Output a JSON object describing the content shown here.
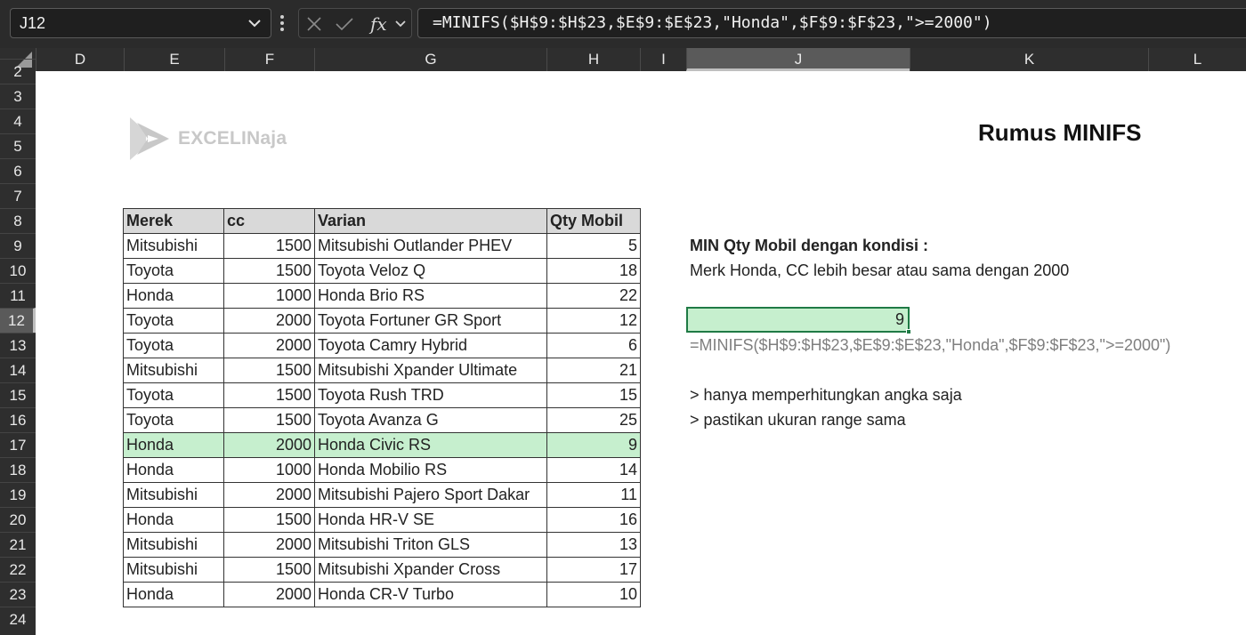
{
  "formula_bar": {
    "name_box": "J12",
    "formula": "=MINIFS($H$9:$H$23,$E$9:$E$23,\"Honda\",$F$9:$F$23,\">=2000\")"
  },
  "columns": [
    "D",
    "E",
    "F",
    "G",
    "H",
    "I",
    "J",
    "K",
    "L"
  ],
  "rows": [
    "2",
    "3",
    "4",
    "5",
    "6",
    "7",
    "8",
    "9",
    "10",
    "11",
    "12",
    "13",
    "14",
    "15",
    "16",
    "17",
    "18",
    "19",
    "20",
    "21",
    "22",
    "23",
    "24"
  ],
  "logo": {
    "text": "EXCELINaja"
  },
  "title": "Rumus MINIFS",
  "table": {
    "headers": [
      "Merek",
      "cc",
      "Varian",
      "Qty Mobil"
    ],
    "rows": [
      [
        "Mitsubishi",
        "1500",
        "Mitsubishi Outlander PHEV",
        "5"
      ],
      [
        "Toyota",
        "1500",
        "Toyota Veloz Q",
        "18"
      ],
      [
        "Honda",
        "1000",
        "Honda Brio RS",
        "22"
      ],
      [
        "Toyota",
        "2000",
        "Toyota Fortuner GR Sport",
        "12"
      ],
      [
        "Toyota",
        "2000",
        "Toyota Camry Hybrid",
        "6"
      ],
      [
        "Mitsubishi",
        "1500",
        "Mitsubishi Xpander Ultimate",
        "21"
      ],
      [
        "Toyota",
        "1500",
        "Toyota Rush TRD",
        "15"
      ],
      [
        "Toyota",
        "1500",
        "Toyota Avanza G",
        "25"
      ],
      [
        "Honda",
        "2000",
        "Honda Civic RS",
        "9"
      ],
      [
        "Honda",
        "1000",
        "Honda Mobilio RS",
        "14"
      ],
      [
        "Mitsubishi",
        "2000",
        "Mitsubishi Pajero Sport Dakar",
        "11"
      ],
      [
        "Honda",
        "1500",
        "Honda HR-V SE",
        "16"
      ],
      [
        "Mitsubishi",
        "2000",
        "Mitsubishi Triton GLS",
        "13"
      ],
      [
        "Mitsubishi",
        "1500",
        "Mitsubishi Xpander Cross",
        "17"
      ],
      [
        "Honda",
        "2000",
        "Honda CR-V Turbo",
        "10"
      ]
    ]
  },
  "notes": {
    "heading": "MIN Qty Mobil dengan kondisi :",
    "condition": "Merk Honda, CC lebih besar atau sama dengan 2000",
    "result": "9",
    "formula_text": "=MINIFS($H$9:$H$23,$E$9:$E$23,\"Honda\",$F$9:$F$23,\">=2000\")",
    "tip1": "> hanya memperhitungkan angka saja",
    "tip2": "> pastikan ukuran range sama"
  },
  "colors": {
    "highlight": "#c6efce",
    "selection_border": "#1f7a45",
    "header_fill": "#d9d9d9"
  }
}
